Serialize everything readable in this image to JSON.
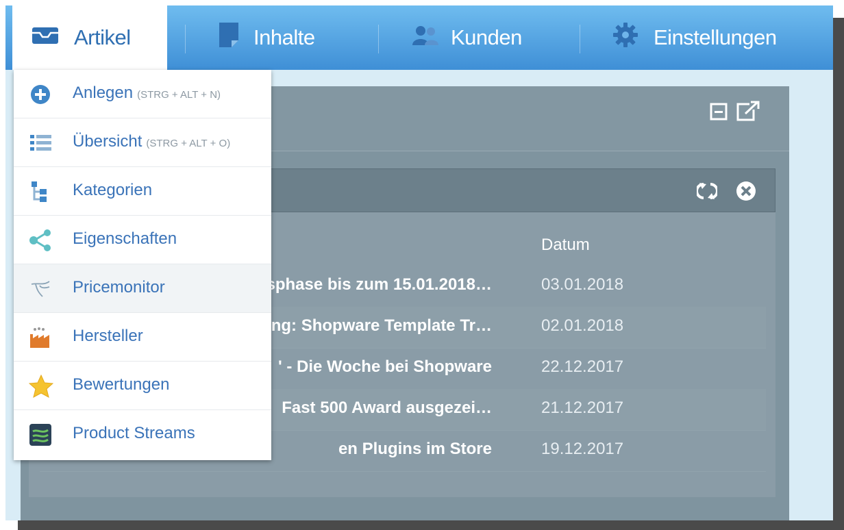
{
  "nav": {
    "items": [
      {
        "label": "Artikel",
        "icon": "inbox-icon",
        "active": true
      },
      {
        "label": "Inhalte",
        "icon": "document-icon"
      },
      {
        "label": "Kunden",
        "icon": "users-icon"
      },
      {
        "label": "Einstellungen",
        "icon": "gear-icon"
      }
    ]
  },
  "menu": {
    "items": [
      {
        "label": "Anlegen",
        "shortcut": "(STRG + ALT + N)",
        "icon": "plus-circle-icon"
      },
      {
        "label": "Übersicht",
        "shortcut": "(STRG + ALT + O)",
        "icon": "list-icon"
      },
      {
        "label": "Kategorien",
        "icon": "tree-icon"
      },
      {
        "label": "Eigenschaften",
        "icon": "share-icon"
      },
      {
        "label": "Pricemonitor",
        "icon": "pricemonitor-icon"
      },
      {
        "label": "Hersteller",
        "icon": "factory-icon"
      },
      {
        "label": "Bewertungen",
        "icon": "star-icon"
      },
      {
        "label": "Product Streams",
        "icon": "streams-icon"
      }
    ]
  },
  "widget": {
    "date_header": "Datum",
    "rows": [
      {
        "title": "sphase bis zum 15.01.2018…",
        "date": "03.01.2018"
      },
      {
        "title": "ng: Shopware Template Tr…",
        "date": "02.01.2018"
      },
      {
        "title": "' - Die Woche bei Shopware",
        "date": "22.12.2017"
      },
      {
        "title": "Fast 500 Award ausgezei…",
        "date": "21.12.2017"
      },
      {
        "title": "en Plugins im Store",
        "date": "19.12.2017"
      }
    ]
  },
  "colors": {
    "nav_top": "#6fbcef",
    "nav_bottom": "#3f8fd6",
    "menu_text": "#3a73b8",
    "widget_bg": "#7f949f"
  }
}
